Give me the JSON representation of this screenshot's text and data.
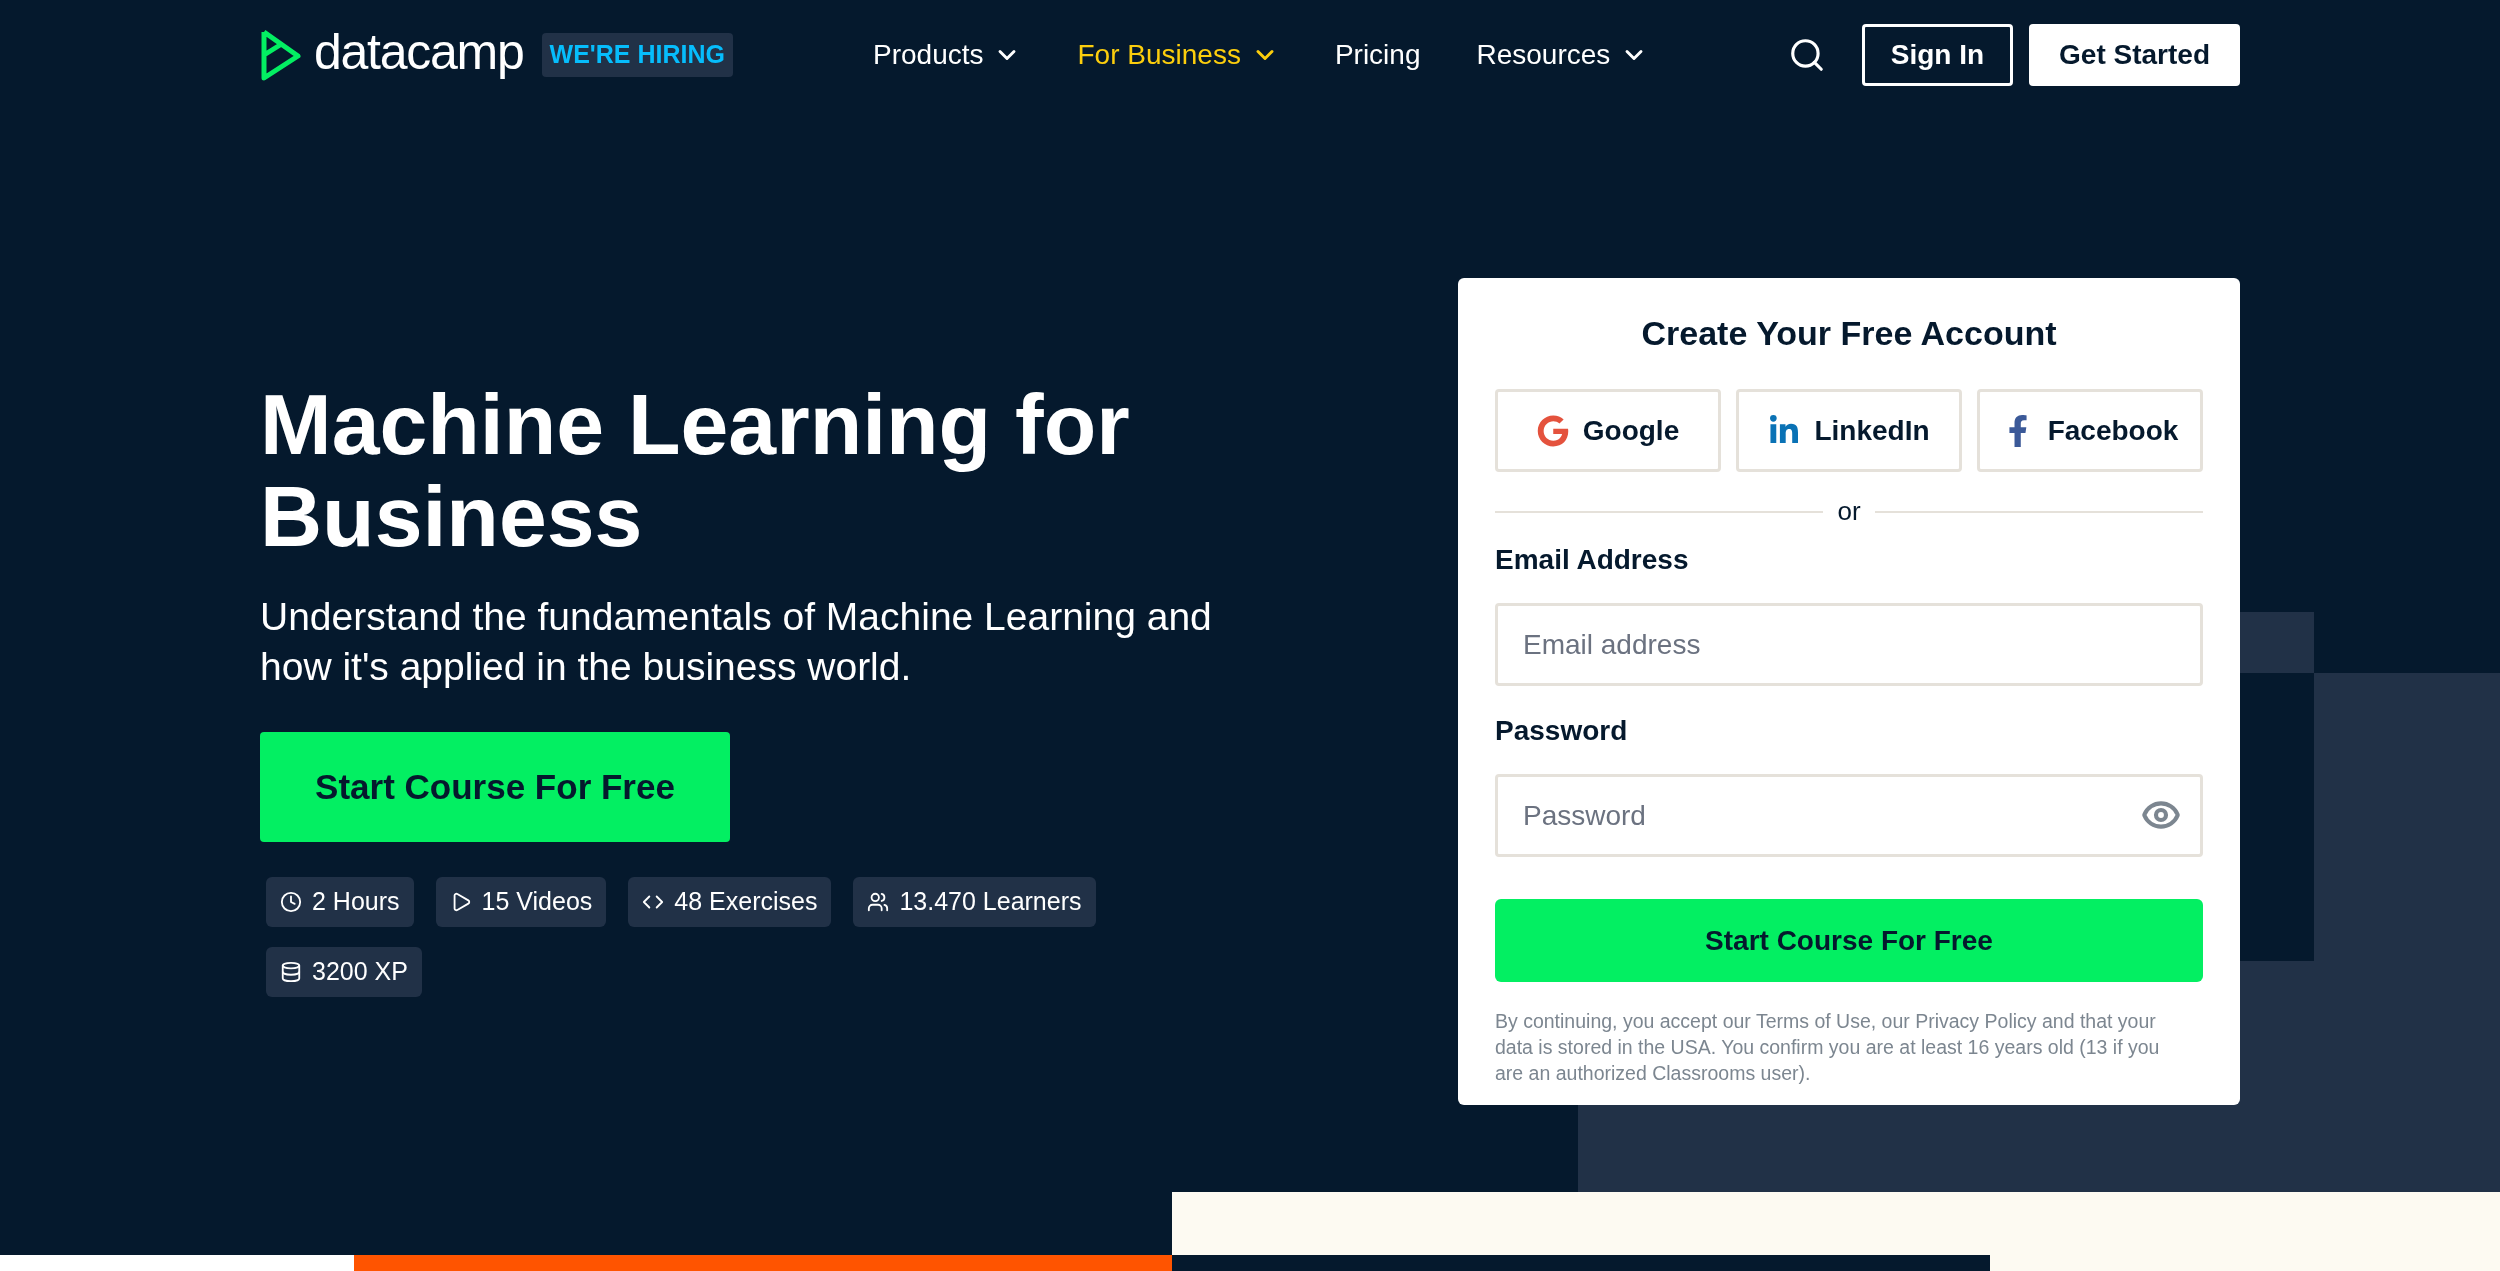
{
  "header": {
    "logo_text": "datacamp",
    "hiring_badge": "WE'RE HIRING",
    "nav": [
      {
        "label": "Products",
        "has_menu": true,
        "selected": false
      },
      {
        "label": "For Business",
        "has_menu": true,
        "selected": true
      },
      {
        "label": "Pricing",
        "has_menu": false,
        "selected": false
      },
      {
        "label": "Resources",
        "has_menu": true,
        "selected": false
      }
    ],
    "sign_in": "Sign In",
    "get_started": "Get Started"
  },
  "hero": {
    "title": "Machine Learning for Business",
    "subtitle": "Understand the fundamentals of Machine Learning and how it's applied in the business world.",
    "cta": "Start Course For Free",
    "stats": [
      {
        "kind": "duration",
        "label": "2 Hours"
      },
      {
        "kind": "videos",
        "label": "15 Videos"
      },
      {
        "kind": "exercises",
        "label": "48 Exercises"
      },
      {
        "kind": "learners",
        "label": "13.470 Learners"
      },
      {
        "kind": "xp",
        "label": "3200 XP"
      }
    ]
  },
  "signup": {
    "title": "Create Your Free Account",
    "social": [
      {
        "kind": "google",
        "label": "Google"
      },
      {
        "kind": "linkedin",
        "label": "LinkedIn"
      },
      {
        "kind": "facebook",
        "label": "Facebook"
      }
    ],
    "divider": "or",
    "email_label": "Email Address",
    "email_placeholder": "Email address",
    "password_label": "Password",
    "password_placeholder": "Password",
    "submit": "Start Course For Free",
    "legal": "By continuing, you accept our Terms of Use, our Privacy Policy and that your data is stored in the USA. You confirm you are at least 16 years old (13 if you are an authorized Classrooms user)."
  }
}
